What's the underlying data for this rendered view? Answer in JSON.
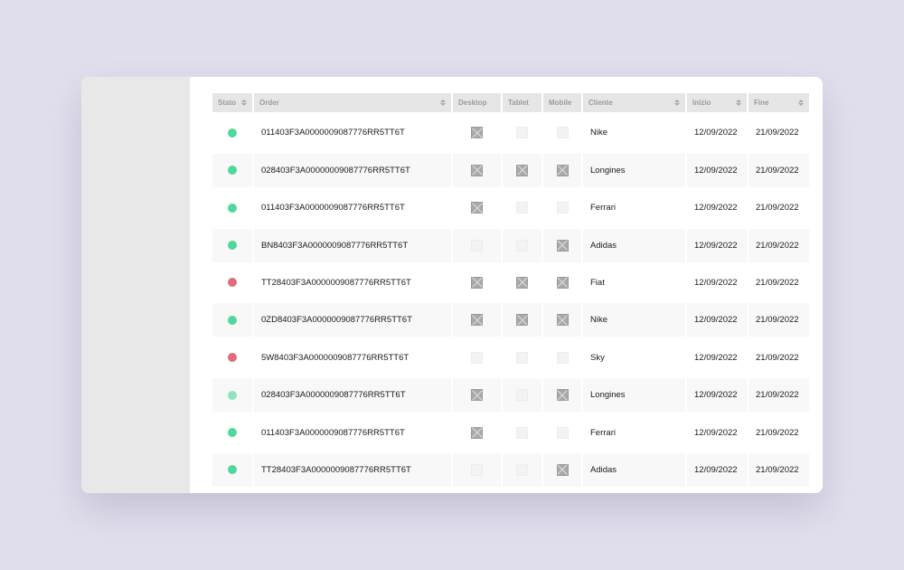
{
  "table": {
    "columns": {
      "stato": "Stato",
      "order": "Order",
      "desktop": "Desktop",
      "tablet": "Tablet",
      "mobile": "Mobile",
      "cliente": "Cliente",
      "inizio": "Inizio",
      "fine": "Fine"
    },
    "status_colors": {
      "active": "#4fd89b",
      "error": "#e26d7a",
      "pending": "#8fe4bf"
    },
    "rows": [
      {
        "status": "active",
        "order": "011403F3A0000009087776RR5TT6T",
        "desktop": true,
        "tablet": false,
        "mobile": false,
        "cliente": "Nike",
        "inizio": "12/09/2022",
        "fine": "21/09/2022"
      },
      {
        "status": "active",
        "order": "028403F3A00000009087776RR5TT6T",
        "desktop": true,
        "tablet": true,
        "mobile": true,
        "cliente": "Longines",
        "inizio": "12/09/2022",
        "fine": "21/09/2022"
      },
      {
        "status": "active",
        "order": "011403F3A0000009087776RR5TT6T",
        "desktop": true,
        "tablet": false,
        "mobile": false,
        "cliente": "Ferrari",
        "inizio": "12/09/2022",
        "fine": "21/09/2022"
      },
      {
        "status": "active",
        "order": "BN8403F3A0000009087776RR5TT6T",
        "desktop": false,
        "tablet": false,
        "mobile": true,
        "cliente": "Adidas",
        "inizio": "12/09/2022",
        "fine": "21/09/2022"
      },
      {
        "status": "error",
        "order": "TT28403F3A0000009087776RR5TT6T",
        "desktop": true,
        "tablet": true,
        "mobile": true,
        "cliente": "Fiat",
        "inizio": "12/09/2022",
        "fine": "21/09/2022"
      },
      {
        "status": "active",
        "order": "0ZD8403F3A0000009087776RR5TT6T",
        "desktop": true,
        "tablet": true,
        "mobile": true,
        "cliente": "Nike",
        "inizio": "12/09/2022",
        "fine": "21/09/2022"
      },
      {
        "status": "error",
        "order": "5W8403F3A0000009087776RR5TT6T",
        "desktop": false,
        "tablet": false,
        "mobile": false,
        "cliente": "Sky",
        "inizio": "12/09/2022",
        "fine": "21/09/2022"
      },
      {
        "status": "pending",
        "order": "028403F3A0000009087776RR5TT6T",
        "desktop": true,
        "tablet": false,
        "mobile": true,
        "cliente": "Longines",
        "inizio": "12/09/2022",
        "fine": "21/09/2022"
      },
      {
        "status": "active",
        "order": "011403F3A0000009087776RR5TT6T",
        "desktop": true,
        "tablet": false,
        "mobile": false,
        "cliente": "Ferrari",
        "inizio": "12/09/2022",
        "fine": "21/09/2022"
      },
      {
        "status": "active",
        "order": "TT28403F3A0000009087776RR5TT6T",
        "desktop": false,
        "tablet": false,
        "mobile": true,
        "cliente": "Adidas",
        "inizio": "12/09/2022",
        "fine": "21/09/2022"
      }
    ]
  }
}
